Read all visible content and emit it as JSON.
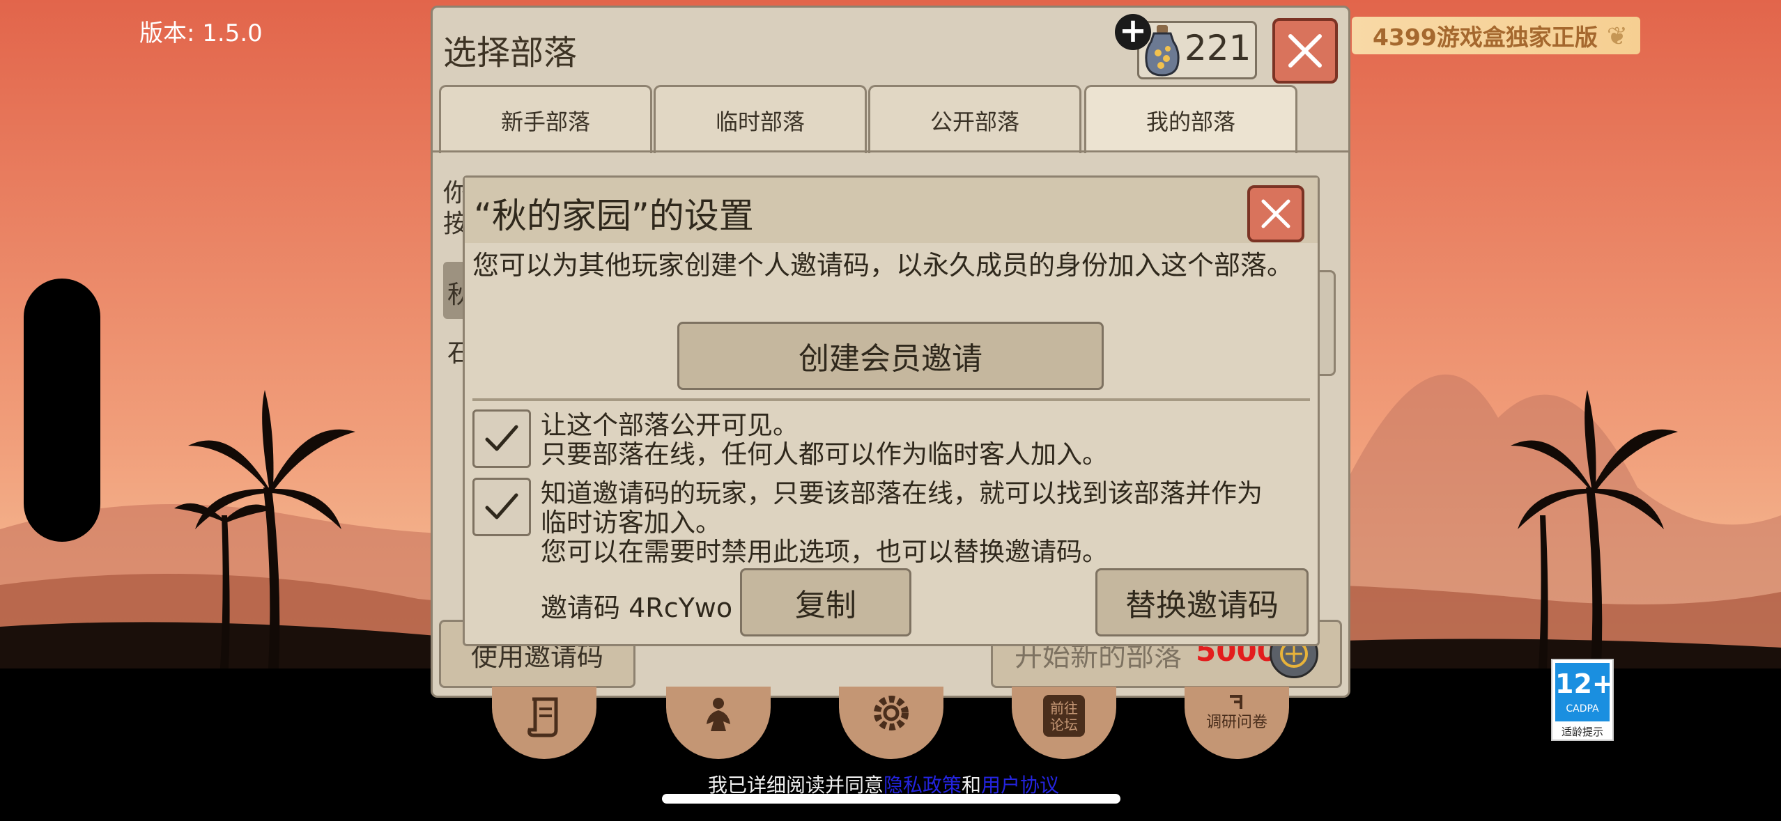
{
  "version_label": "版本: 1.5.0",
  "promo_badge": "4399游戏盒独家正版",
  "tribe_panel": {
    "title": "选择部落",
    "coin_count": "221",
    "tabs": [
      {
        "label": "新手部落",
        "active": false
      },
      {
        "label": "临时部落",
        "active": false
      },
      {
        "label": "公开部落",
        "active": false
      },
      {
        "label": "我的部落",
        "active": true
      }
    ],
    "partial_text_1": "你",
    "partial_text_2": "按",
    "partial_row_1": "秋",
    "partial_row_2": "石",
    "use_invite_code_label": "使用邀请码",
    "start_new_tribe_label": "开始新的部落",
    "start_new_tribe_cost": "5000"
  },
  "settings_dialog": {
    "title": "“秋的家园”的设置",
    "description": "您可以为其他玩家创建个人邀请码，以永久成员的身份加入这个部落。",
    "create_invite_label": "创建会员邀请",
    "option_public": {
      "checked": true,
      "line1": "让这个部落公开可见。",
      "line2": "只要部落在线，任何人都可以作为临时客人加入。"
    },
    "option_invite": {
      "checked": true,
      "line1": "知道邀请码的玩家，只要该部落在线，就可以找到该部落并作为",
      "line2": "临时访客加入。",
      "line3": "您可以在需要时禁用此选项，也可以替换邀请码。"
    },
    "invite_code_label": "邀请码",
    "invite_code_value": "4RcYwo",
    "copy_label": "复制",
    "replace_label": "替换邀请码"
  },
  "bottom_menu": [
    {
      "name": "scroll-icon"
    },
    {
      "name": "meditation-icon"
    },
    {
      "name": "gear-icon"
    },
    {
      "name": "forum-icon",
      "label": "前往论坛"
    },
    {
      "name": "survey-icon",
      "label": "调研问卷"
    }
  ],
  "footer": {
    "prefix": "我已详细阅读并同意",
    "privacy_link": "隐私政策",
    "and": "和",
    "user_agreement_link": "用户协议"
  },
  "age_rating": {
    "number": "12+",
    "org": "CADPA",
    "hint": "适龄提示"
  },
  "colors": {
    "sky_top": "#e36a4e",
    "sky_bottom": "#f3b48c",
    "panel_bg": "#d9cfbd",
    "close_red": "#d9735c",
    "cost_red": "#e31d1d",
    "link_blue": "#2424e0"
  }
}
